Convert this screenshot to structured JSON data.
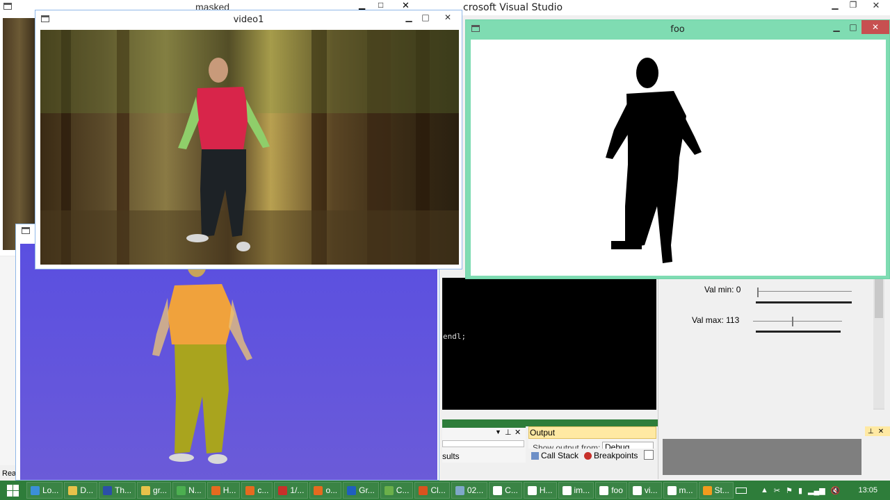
{
  "masked": {
    "title": "masked"
  },
  "vs": {
    "title": "ing) - Microsoft Visual Studio",
    "code": "endl;",
    "status_left": "Rea"
  },
  "video1": {
    "title": "video1"
  },
  "foo": {
    "title": "foo"
  },
  "trackbars": {
    "val_min": "Val min: 0",
    "val_max": "Val max: 113",
    "val_min_value": 0,
    "val_max_value": 113,
    "max": 255
  },
  "output_panel": {
    "title": "Output",
    "show_output_from": "Show output from:",
    "dropdown": "Debug",
    "results_tab": "sults",
    "call_stack": "Call Stack",
    "breakpoints": "Breakpoints"
  },
  "taskbar": {
    "items": [
      {
        "label": "Lo...",
        "color": "#3b8fd8"
      },
      {
        "label": "D...",
        "color": "#e8c24a"
      },
      {
        "label": "Th...",
        "color": "#2b4fa8"
      },
      {
        "label": "gr...",
        "color": "#e8c24a"
      },
      {
        "label": "N...",
        "color": "#4caf50"
      },
      {
        "label": "H...",
        "color": "#e66a1f"
      },
      {
        "label": "c...",
        "color": "#e66a1f"
      },
      {
        "label": "1/...",
        "color": "#c7302a"
      },
      {
        "label": "o...",
        "color": "#e66a1f"
      },
      {
        "label": "Gr...",
        "color": "#1f5fbf"
      },
      {
        "label": "C...",
        "color": "#6bb04a"
      },
      {
        "label": "Cl...",
        "color": "#d9531e"
      },
      {
        "label": "02...",
        "color": "#7fa8c9"
      },
      {
        "label": "C...",
        "color": "#ffffff"
      },
      {
        "label": "H...",
        "color": "#ffffff"
      },
      {
        "label": "im...",
        "color": "#ffffff"
      },
      {
        "label": "foo",
        "color": "#ffffff"
      },
      {
        "label": "vi...",
        "color": "#ffffff"
      },
      {
        "label": "m...",
        "color": "#ffffff"
      },
      {
        "label": "St...",
        "color": "#f29b1d"
      }
    ],
    "clock": "13:05"
  }
}
